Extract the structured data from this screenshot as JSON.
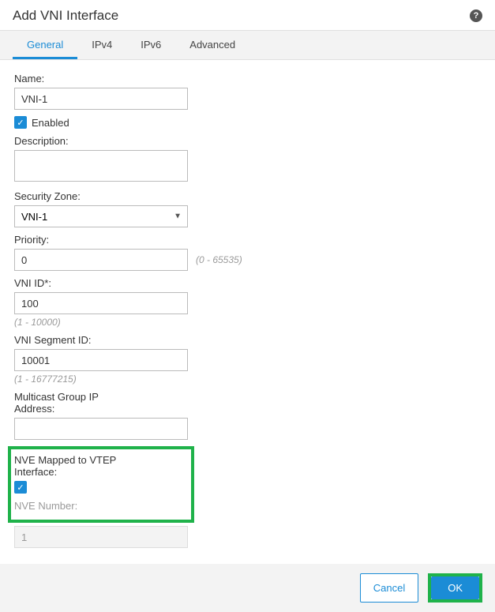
{
  "dialog": {
    "title": "Add VNI Interface"
  },
  "tabs": {
    "general": "General",
    "ipv4": "IPv4",
    "ipv6": "IPv6",
    "advanced": "Advanced"
  },
  "form": {
    "name_label": "Name:",
    "name_value": "VNI-1",
    "enabled_label": "Enabled",
    "enabled_checked": true,
    "description_label": "Description:",
    "description_value": "",
    "security_zone_label": "Security Zone:",
    "security_zone_value": "VNI-1",
    "priority_label": "Priority:",
    "priority_value": "0",
    "priority_hint": "(0 - 65535)",
    "vni_id_label": "VNI ID*:",
    "vni_id_value": "100",
    "vni_id_hint": "(1 - 10000)",
    "vni_segment_label": "VNI Segment ID:",
    "vni_segment_value": "10001",
    "vni_segment_hint": "(1 - 16777215)",
    "multicast_label": "Multicast Group IP Address:",
    "multicast_value": "",
    "nve_mapped_label": "NVE Mapped to VTEP Interface:",
    "nve_mapped_checked": true,
    "nve_number_label": "NVE Number:",
    "nve_number_value": "1"
  },
  "footer": {
    "cancel": "Cancel",
    "ok": "OK"
  }
}
